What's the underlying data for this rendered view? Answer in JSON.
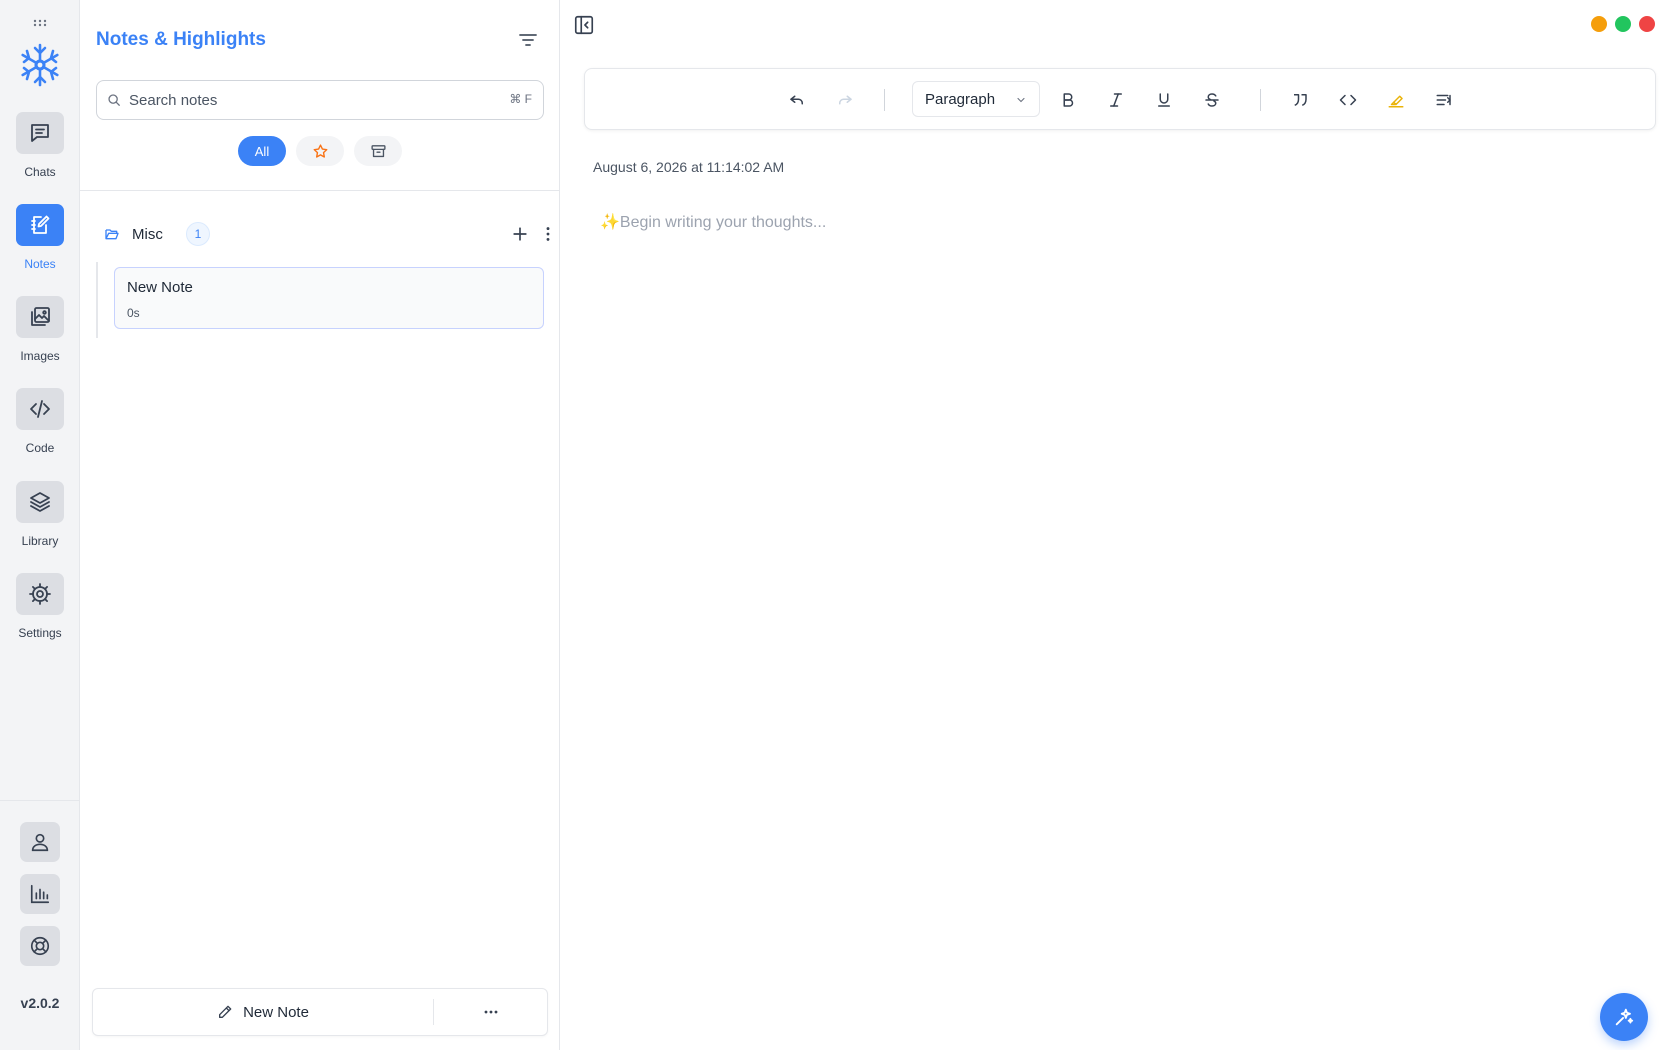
{
  "rail": {
    "items": [
      {
        "label": "Chats",
        "icon": "chat-icon"
      },
      {
        "label": "Notes",
        "icon": "notes-icon",
        "active": true
      },
      {
        "label": "Images",
        "icon": "images-icon"
      },
      {
        "label": "Code",
        "icon": "code-icon"
      },
      {
        "label": "Library",
        "icon": "layers-icon"
      },
      {
        "label": "Settings",
        "icon": "gear-icon"
      }
    ],
    "utility_icons": [
      "user-icon",
      "chart-icon",
      "help-icon"
    ],
    "version": "v2.0.2"
  },
  "panel": {
    "title": "Notes & Highlights",
    "search": {
      "placeholder": "Search notes",
      "shortcut": "⌘ F"
    },
    "filters": {
      "all_label": "All",
      "active": "All"
    },
    "folder": {
      "name": "Misc",
      "count": "1"
    },
    "notes": [
      {
        "title": "New Note",
        "time": "0s"
      }
    ],
    "new_note_label": "New Note"
  },
  "editor": {
    "format_selected": "Paragraph",
    "date": "August 6, 2026 at 11:14:02 AM",
    "placeholder": "✨Begin writing your thoughts..."
  },
  "colors": {
    "accent": "#3b82f6",
    "traffic_orange": "#f59e0b",
    "traffic_green": "#22c55e",
    "traffic_red": "#ef4444",
    "star": "#f97316",
    "highlighter": "#eab308"
  }
}
